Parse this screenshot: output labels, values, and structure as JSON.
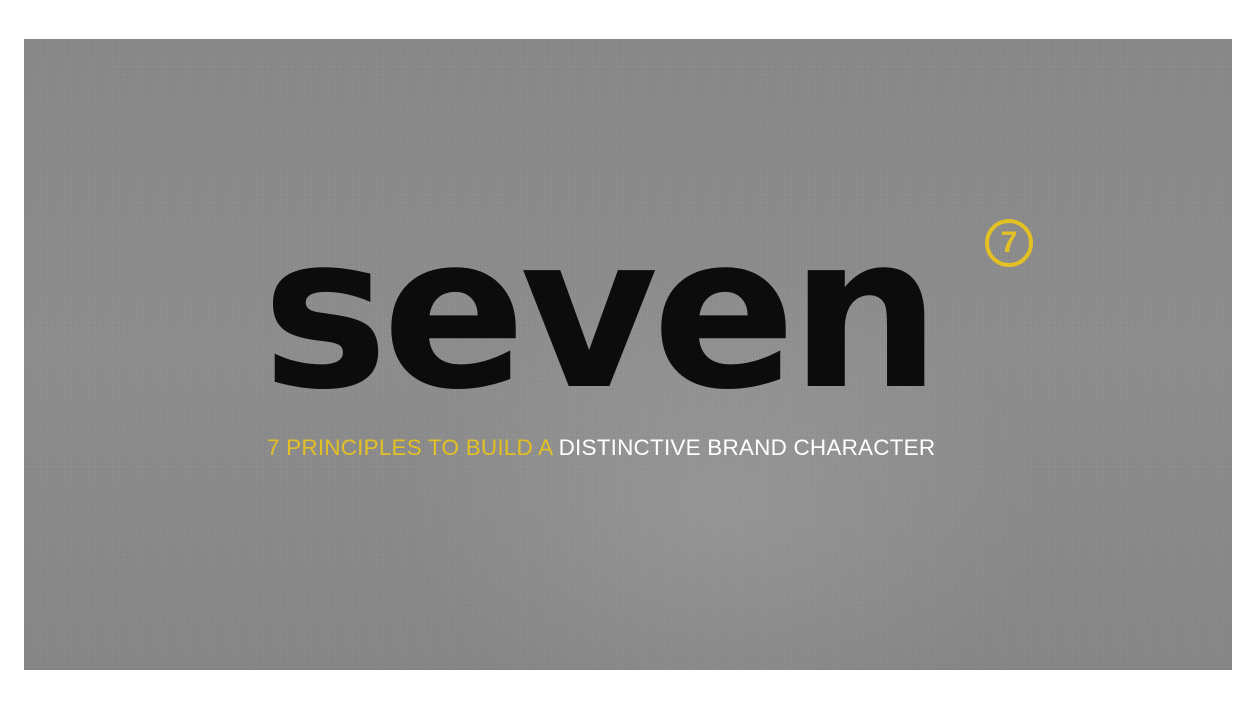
{
  "slide": {
    "wordmark": "seven",
    "badge_number": "7",
    "tagline_highlight": "7 PRINCIPLES TO BUILD A",
    "tagline_rest": "DISTINCTIVE BRAND CHARACTER"
  },
  "colors": {
    "accent": "#e3c024",
    "wordmark": "#0c0c0c",
    "background": "#8c8c8c",
    "tagline_plain": "#ffffff"
  }
}
